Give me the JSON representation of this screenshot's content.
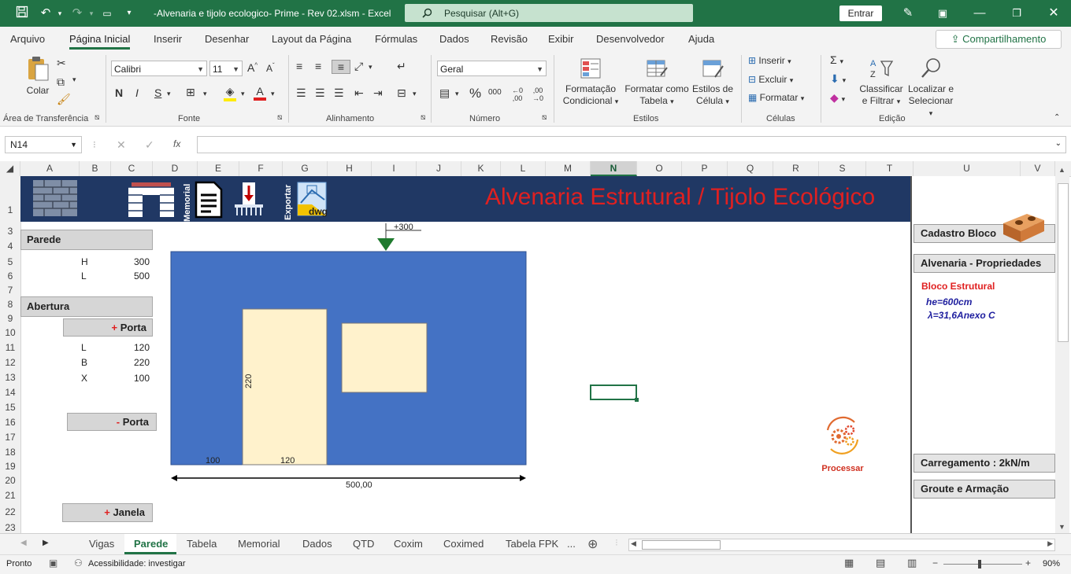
{
  "titlebar": {
    "title": "-Alvenaria e tijolo ecologico- Prime - Rev 02.xlsm  -  Excel",
    "search_placeholder": "Pesquisar (Alt+G)",
    "signin_label": "Entrar",
    "accent_color": "#217346"
  },
  "menu": {
    "items": [
      "Arquivo",
      "Página Inicial",
      "Inserir",
      "Desenhar",
      "Layout da Página",
      "Fórmulas",
      "Dados",
      "Revisão",
      "Exibir",
      "Desenvolvedor",
      "Ajuda"
    ],
    "active": "Página Inicial",
    "share_label": "Compartilhamento"
  },
  "ribbon": {
    "clipboard": {
      "paste_label": "Colar",
      "group_label": "Área de Transferência"
    },
    "font": {
      "font_name": "Calibri",
      "font_size": "11",
      "bold": "N",
      "italic": "I",
      "underline": "S",
      "group_label": "Fonte"
    },
    "alignment": {
      "group_label": "Alinhamento"
    },
    "number": {
      "format": "Geral",
      "group_label": "Número"
    },
    "styles": {
      "cond_line1": "Formatação",
      "cond_line2": "Condicional",
      "table_line1": "Formatar como",
      "table_line2": "Tabela",
      "cell_line1": "Estilos de",
      "cell_line2": "Célula",
      "group_label": "Estilos"
    },
    "cells": {
      "insert": "Inserir",
      "delete": "Excluir",
      "format": "Formatar",
      "group_label": "Células"
    },
    "editing": {
      "sort_line1": "Classificar",
      "sort_line2": "e Filtrar",
      "find_line1": "Localizar e",
      "find_line2": "Selecionar",
      "group_label": "Edição"
    }
  },
  "formula_bar": {
    "name_box": "N14",
    "fx": "fx",
    "value": ""
  },
  "columns": [
    "A",
    "B",
    "C",
    "D",
    "E",
    "F",
    "G",
    "H",
    "I",
    "J",
    "K",
    "L",
    "M",
    "N",
    "O",
    "P",
    "Q",
    "R",
    "S",
    "T",
    "U",
    "V"
  ],
  "rows": [
    "1",
    "3",
    "4",
    "5",
    "6",
    "7",
    "8",
    "9",
    "10",
    "11",
    "12",
    "13",
    "14",
    "15",
    "16",
    "17",
    "18",
    "19",
    "20",
    "21",
    "22",
    "23"
  ],
  "selected_column": "N",
  "banner": {
    "title": "Alvenaria Estrutural / Tijolo Ecológico",
    "memorial_label": "Memorial",
    "exportar_label": "Exportar",
    "dwg_label": "dwg",
    "bg_color": "#203864",
    "title_color": "#e02020"
  },
  "sheet": {
    "parede_label": "Parede",
    "h_label": "H",
    "h_value": "300",
    "l_label": "L",
    "l_value": "500",
    "abertura_label": "Abertura",
    "add_porta_sign": "+",
    "add_porta_label": "Porta",
    "porta_l_label": "L",
    "porta_l_value": "120",
    "porta_b_label": "B",
    "porta_b_value": "220",
    "porta_x_label": "X",
    "porta_x_value": "100",
    "remove_porta_sign": "-",
    "remove_porta_label": "Porta",
    "add_janela_sign": "+",
    "add_janela_label": "Janela"
  },
  "drawing": {
    "level_label": "+300",
    "door_height_label": "220",
    "door_offset_label": "100",
    "door_width_label": "120",
    "wall_length_label": "500,00",
    "wall_color": "#4472c4",
    "opening_color": "#fff2cc"
  },
  "process": {
    "label": "Processar"
  },
  "side_panel": {
    "cadastro_label": "Cadastro Bloco",
    "propriedades_label": "Alvenaria - Propriedades",
    "bloco_label": "Bloco Estrutural",
    "he_label": "he=600cm",
    "lambda_label": "λ=31,6Anexo C",
    "carregamento_label": "Carregamento : 2kN/m",
    "groute_label": "Groute e Armação"
  },
  "tabs": {
    "items": [
      "Vigas",
      "Parede",
      "Tabela",
      "Memorial",
      "Dados",
      "QTD",
      "Coxim",
      "Coximed",
      "Tabela FPK"
    ],
    "active": "Parede",
    "more": "..."
  },
  "status": {
    "ready": "Pronto",
    "accessibility": "Acessibilidade: investigar",
    "zoom": "90%"
  }
}
